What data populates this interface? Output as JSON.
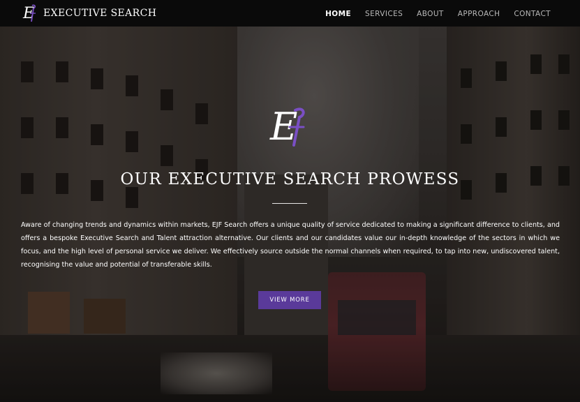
{
  "header": {
    "brand_name": "EXECUTIVE SEARCH",
    "logo_icon": "ejf-monogram-logo"
  },
  "nav": {
    "items": [
      {
        "label": "HOME",
        "active": true
      },
      {
        "label": "SERVICES",
        "active": false
      },
      {
        "label": "ABOUT",
        "active": false
      },
      {
        "label": "APPROACH",
        "active": false
      },
      {
        "label": "CONTACT",
        "active": false
      }
    ]
  },
  "hero": {
    "title": "OUR EXECUTIVE SEARCH PROWESS",
    "body": "Aware of changing trends and dynamics within markets, EJF Search offers a unique quality of service dedicated to making a significant difference to clients, and offers a bespoke Executive Search and Talent attraction alternative. Our clients and our candidates value our in-depth knowledge of the sectors in which we focus, and the high level of personal service we deliver. We effectively source outside the normal channels when required, to tap into new, undiscovered talent, recognising the value and potential of transferable skills.",
    "cta_label": "VIEW MORE",
    "background_image": "city-street-background"
  },
  "colors": {
    "navbar_bg": "#0a0a0a",
    "accent_purple": "#5a3a9a",
    "text_white": "#ffffff",
    "nav_inactive": "#b9b9b9"
  }
}
